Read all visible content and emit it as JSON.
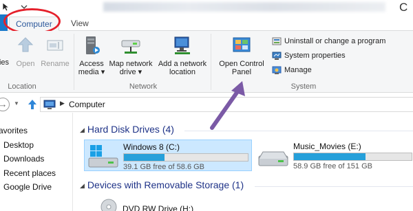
{
  "window": {
    "title": "C"
  },
  "ribbon": {
    "tabs": [
      {
        "label": "Computer"
      },
      {
        "label": "View"
      }
    ],
    "groups": {
      "location": {
        "label": "Location",
        "buttons": [
          {
            "label": "ies"
          },
          {
            "label": "Open"
          },
          {
            "label": "Rename"
          }
        ]
      },
      "network": {
        "label": "Network",
        "buttons": [
          {
            "label_line1": "Access",
            "label_line2": "media ▾"
          },
          {
            "label_line1": "Map network",
            "label_line2": "drive ▾"
          },
          {
            "label_line1": "Add a network",
            "label_line2": "location"
          }
        ]
      },
      "system": {
        "label": "System",
        "open_control_panel": {
          "label_line1": "Open Control",
          "label_line2": "Panel"
        },
        "small_buttons": [
          {
            "label": "Uninstall or change a program"
          },
          {
            "label": "System properties"
          },
          {
            "label": "Manage"
          }
        ]
      }
    }
  },
  "address_bar": {
    "path": "Computer"
  },
  "nav_pane": {
    "items": [
      {
        "label": "avorites"
      },
      {
        "label": "Desktop"
      },
      {
        "label": "Downloads"
      },
      {
        "label": "Recent places"
      },
      {
        "label": "Google Drive"
      }
    ]
  },
  "content": {
    "hard_disk_section": {
      "label": "Hard Disk Drives (4)"
    },
    "drives": [
      {
        "name": "Windows 8 (C:)",
        "free_text": "39.1 GB free of 58.6 GB",
        "used_fraction": 0.33
      },
      {
        "name": "Music_Movies (E:)",
        "free_text": "58.9 GB free of 151 GB",
        "used_fraction": 0.61
      }
    ],
    "removable_section": {
      "label": "Devices with Removable Storage (1)"
    },
    "removable_devices": [
      {
        "name": "DVD RW Drive (H:)"
      }
    ]
  },
  "colors": {
    "accent": "#1979ca",
    "annotation_circle": "#e5202b",
    "annotation_arrow": "#7b5aa6",
    "drive_bar_fill": "#26a0da",
    "selection": "#cce8ff"
  }
}
